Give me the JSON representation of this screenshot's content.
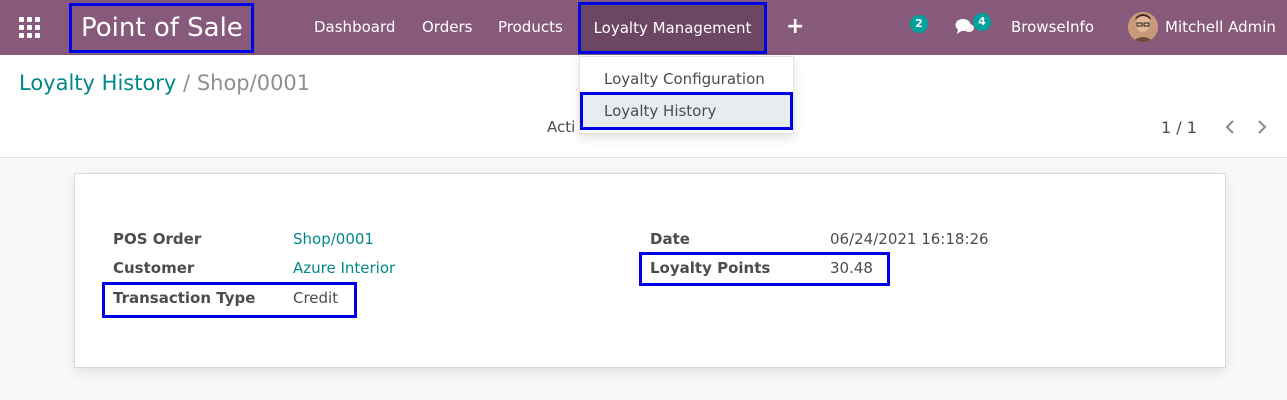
{
  "navbar": {
    "app_title": "Point of Sale",
    "menu": [
      "Dashboard",
      "Orders",
      "Products"
    ],
    "active_menu": "Loyalty Management",
    "plus": "+",
    "activity_badge": "2",
    "message_badge": "4",
    "company": "BrowseInfo",
    "user": "Mitchell Admin",
    "color": "#875a7b"
  },
  "breadcrumb": {
    "parent": "Loyalty History",
    "separator": "/",
    "current": "Shop/0001"
  },
  "control_panel": {
    "action_text": "Acti",
    "pager": "1 / 1"
  },
  "dropdown": {
    "items": [
      "Loyalty Configuration",
      "Loyalty History"
    ],
    "selected": "Loyalty History"
  },
  "form": {
    "pos_order_label": "POS Order",
    "pos_order_value": "Shop/0001",
    "customer_label": "Customer",
    "customer_value": "Azure Interior",
    "transaction_type_label": "Transaction Type",
    "transaction_type_value": "Credit",
    "date_label": "Date",
    "date_value": "06/24/2021 16:18:26",
    "loyalty_points_label": "Loyalty Points",
    "loyalty_points_value": "30.48"
  },
  "icons": [
    "apps-grid-icon",
    "chat-icon",
    "chevron-left-icon",
    "chevron-right-icon",
    "avatar"
  ],
  "colors": {
    "accent": "#00878a",
    "highlight": "#0000e6",
    "badge": "#00a09d"
  }
}
